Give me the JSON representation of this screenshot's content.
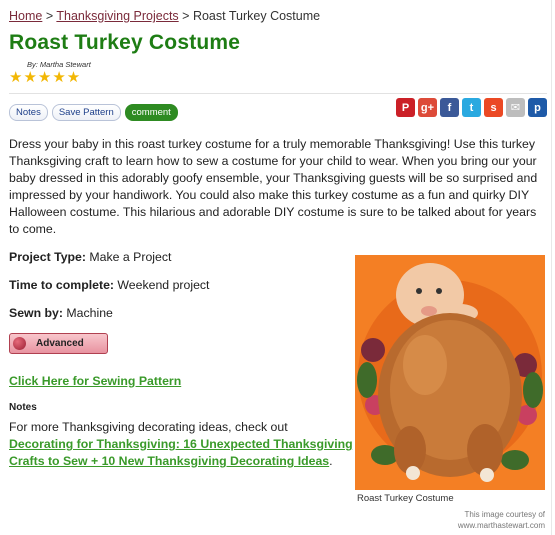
{
  "breadcrumb": {
    "home": "Home",
    "sep1": ">",
    "projects": "Thanksgiving Projects",
    "sep2": ">",
    "current": "Roast Turkey Costume"
  },
  "title": "Roast Turkey Costume",
  "byline": "By: Martha Stewart",
  "rating": {
    "stars": "★★★★★",
    "value": 5,
    "max": 5
  },
  "toolbar": {
    "notes": "Notes",
    "save": "Save Pattern",
    "comment": "comment"
  },
  "social": [
    {
      "name": "pinterest-icon",
      "glyph": "P",
      "color": "#cb2027"
    },
    {
      "name": "google-plus-icon",
      "glyph": "g+",
      "color": "#dd4b39"
    },
    {
      "name": "facebook-icon",
      "glyph": "f",
      "color": "#3b5998"
    },
    {
      "name": "twitter-icon",
      "glyph": "t",
      "color": "#2aa9e0"
    },
    {
      "name": "stumbleupon-icon",
      "glyph": "s",
      "color": "#eb4924"
    },
    {
      "name": "email-icon",
      "glyph": "✉",
      "color": "#bdbdbd"
    },
    {
      "name": "print-icon",
      "glyph": "p",
      "color": "#1e5aa8"
    }
  ],
  "intro": "Dress your baby in this roast turkey costume for a truly memorable Thanksgiving! Use this turkey Thanksgiving craft to learn how to sew a costume for your child to wear. When you bring our your baby dressed in this adorably goofy ensemble, your Thanksgiving guests will be so surprised and impressed by your handiwork. You could also make this turkey costume as a fun and quirky DIY Halloween costume. This hilarious and adorable DIY costume is sure to be talked about for years to come.",
  "meta": {
    "project_type_label": "Project Type:",
    "project_type": "Make a Project",
    "time_label": "Time to complete:",
    "time": "Weekend project",
    "sewn_label": "Sewn by:",
    "sewn": "Machine"
  },
  "level": "Advanced",
  "pattern_link": "Click Here for Sewing Pattern",
  "notes": {
    "heading": "Notes",
    "text": "For more Thanksgiving decorating ideas, check out",
    "link": "Decorating for Thanksgiving: 16 Unexpected Thanksgiving Crafts to Sew + 10 New Thanksgiving Decorating Ideas",
    "end": "."
  },
  "image": {
    "caption": "Roast Turkey Costume",
    "credit1": "This image courtesy of",
    "credit2": "www.marthastewart.com"
  }
}
